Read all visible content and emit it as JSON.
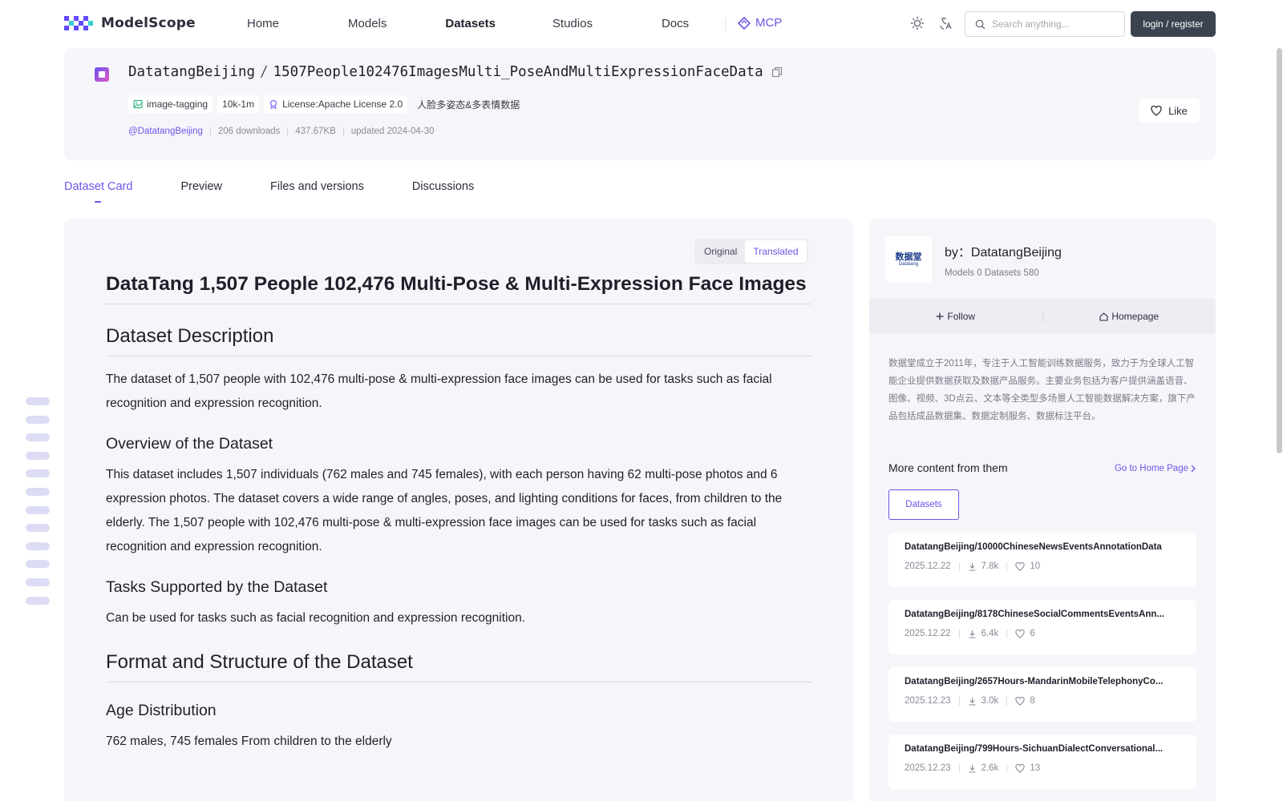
{
  "nav": {
    "logo_text": "ModelScope",
    "links": [
      "Home",
      "Models",
      "Datasets",
      "Studios",
      "Docs"
    ],
    "active": "Datasets",
    "mcp_label": "MCP",
    "search_placeholder": "Search anything...",
    "login_label": "login / register",
    "icons": [
      "sun-icon",
      "translate-icon",
      "search-icon"
    ]
  },
  "dataset": {
    "owner": "DatatangBeijing",
    "separator": "/",
    "name": "1507People102476ImagesMulti_PoseAndMultiExpressionFaceData",
    "tags": [
      {
        "label": "image-tagging",
        "icon": "tag-icon"
      },
      {
        "label": "10k-1m",
        "icon": ""
      },
      {
        "label": "License:Apache License 2.0",
        "icon": "license-icon"
      },
      {
        "label": "人脸多姿态&多表情数据",
        "icon": ""
      }
    ],
    "author_handle": "@DatatangBeijing",
    "downloads": "206 downloads",
    "size": "437.67KB",
    "updated": "updated 2024-04-30",
    "like_label": "Like"
  },
  "tabs": [
    "Dataset Card",
    "Preview",
    "Files and versions",
    "Discussions"
  ],
  "active_tab": "Dataset Card",
  "toggle": {
    "original": "Original",
    "translated": "Translated",
    "selected": "Translated"
  },
  "card": {
    "h1": "DataTang 1,507 People 102,476 Multi-Pose & Multi-Expression Face Images",
    "h2_description": "Dataset Description",
    "p_description": "The dataset of 1,507 people with 102,476 multi-pose & multi-expression face images can be used for tasks such as facial recognition and expression recognition.",
    "h3_overview": "Overview of the Dataset",
    "p_overview": "This dataset includes 1,507 individuals (762 males and 745 females), with each person having 62 multi-pose photos and 6 expression photos. The dataset covers a wide range of angles, poses, and lighting conditions for faces, from children to the elderly. The 1,507 people with 102,476 multi-pose & multi-expression face images can be used for tasks such as facial recognition and expression recognition.",
    "h3_tasks": "Tasks Supported by the Dataset",
    "p_tasks": "Can be used for tasks such as facial recognition and expression recognition.",
    "h2_format": "Format and Structure of the Dataset",
    "h3_age": "Age Distribution",
    "p_age": "762 males, 745 females From children to the elderly"
  },
  "sidebar": {
    "by_label": "by：DatatangBeijing",
    "org_logo_text": "数据堂",
    "org_logo_sub": "Datatang",
    "stats": "Models 0  Datasets 580",
    "follow_label": "Follow",
    "homepage_label": "Homepage",
    "description": "数据堂成立于2011年，专注于人工智能训练数据服务，致力于为全球人工智能企业提供数据获取及数据产品服务。主要业务包括为客户提供涵盖语音、图像、视频、3D点云、文本等全类型多场景人工智能数据解决方案，旗下产品包括成品数据集、数据定制服务、数据标注平台。",
    "more_title": "More content from them",
    "goto_label": "Go to Home Page",
    "datasets_tab": "Datasets",
    "related": [
      {
        "name": "DatatangBeijing/10000ChineseNewsEventsAnnotationData",
        "date": "2025.12.22",
        "downloads": "7.8k",
        "likes": "10"
      },
      {
        "name": "DatatangBeijing/8178ChineseSocialCommentsEventsAnn...",
        "date": "2025.12.22",
        "downloads": "6.4k",
        "likes": "6"
      },
      {
        "name": "DatatangBeijing/2657Hours-MandarinMobileTelephonyCo...",
        "date": "2025.12.23",
        "downloads": "3.0k",
        "likes": "8"
      },
      {
        "name": "DatatangBeijing/799Hours-SichuanDialectConversational...",
        "date": "2025.12.23",
        "downloads": "2.6k",
        "likes": "13"
      }
    ]
  },
  "colors": {
    "accent": "#6b56e8",
    "login_bg": "#3c4350",
    "card_bg": "#f6f6fa"
  }
}
